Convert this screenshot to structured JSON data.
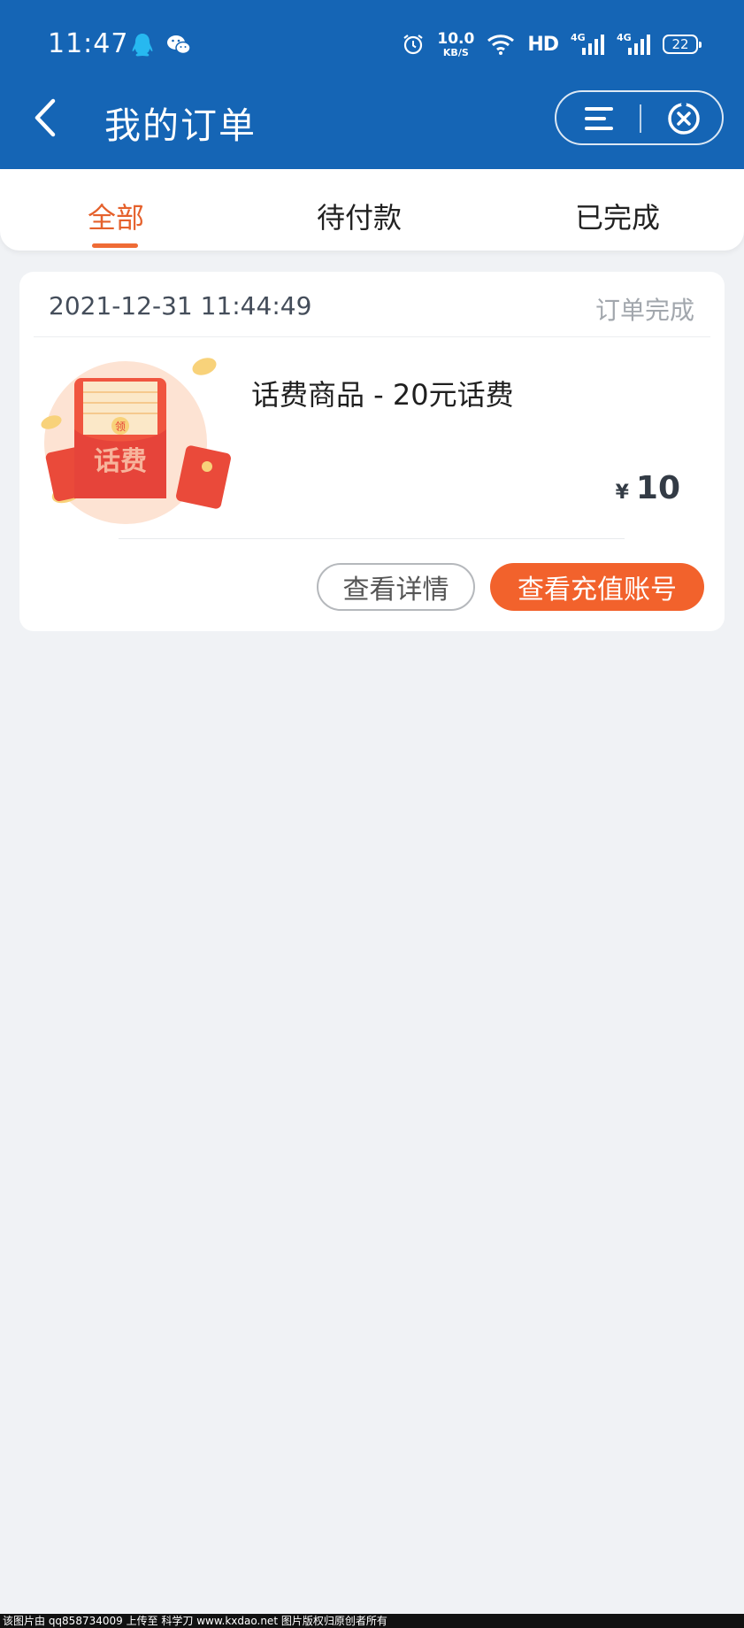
{
  "status_bar": {
    "time": "11:47",
    "net_speed_value": "10.0",
    "net_speed_unit": "KB/S",
    "hd_label": "HD",
    "signal1_label": "4G",
    "signal2_label": "4G",
    "battery": "22"
  },
  "header": {
    "title": "我的订单",
    "background_color": "#1565b5",
    "back_icon": "chevron-left-icon",
    "menu_icon": "menu-icon",
    "close_icon": "close-circle-icon"
  },
  "tabs": [
    {
      "label": "全部",
      "active": true
    },
    {
      "label": "待付款",
      "active": false
    },
    {
      "label": "已完成",
      "active": false
    }
  ],
  "accent_color": "#f2622c",
  "order": {
    "time": "2021-12-31 11:44:49",
    "status": "订单完成",
    "product_name": "话费商品 - 20元话费",
    "product_image_text": "话费",
    "product_image_badge": "领",
    "currency": "¥",
    "price": "10",
    "detail_button": "查看详情",
    "account_button": "查看充值账号"
  },
  "watermark": "该图片由 qq858734009 上传至 科学刀 www.kxdao.net 图片版权归原创者所有"
}
